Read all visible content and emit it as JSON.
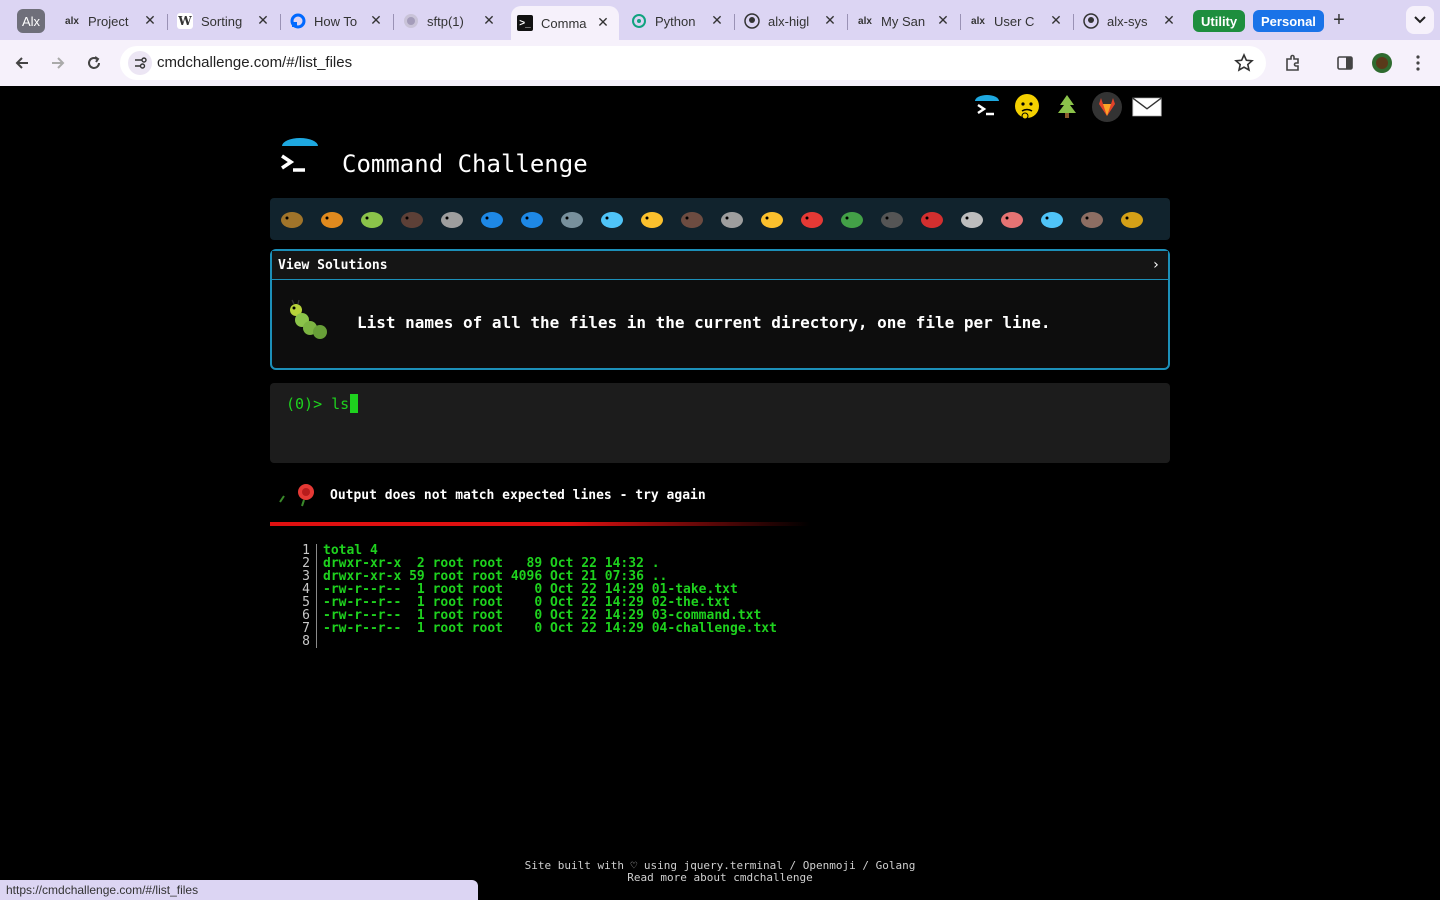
{
  "browser": {
    "profile_badge": "Alx",
    "tabs": [
      {
        "title": "Project",
        "icon": "alx-icon"
      },
      {
        "title": "Sorting",
        "icon": "wikipedia-icon"
      },
      {
        "title": "How To",
        "icon": "digitalocean-icon"
      },
      {
        "title": "sftp(1)",
        "icon": "globe-icon"
      },
      {
        "title": "Comma",
        "icon": "terminal-icon",
        "active": true
      },
      {
        "title": "Python",
        "icon": "chatgpt-icon"
      },
      {
        "title": "alx-higl",
        "icon": "github-icon"
      },
      {
        "title": "My San",
        "icon": "alx-icon"
      },
      {
        "title": "User C",
        "icon": "alx-icon"
      },
      {
        "title": "alx-sys",
        "icon": "github-icon"
      }
    ],
    "groups": [
      {
        "label": "Utility",
        "color": "#1e8e3e"
      },
      {
        "label": "Personal",
        "color": "#1a73e8"
      }
    ],
    "url": "cmdchallenge.com/#/list_files",
    "status_url": "https://cmdchallenge.com/#/list_files"
  },
  "page": {
    "title": "Command Challenge",
    "level_icons": [
      "snail-icon",
      "butterfly-icon",
      "caterpillar-icon",
      "ant-icon",
      "microbe-icon",
      "whale-icon",
      "dolphin-icon",
      "shark-icon",
      "fish-icon",
      "tropical-fish-icon",
      "hedgehog-icon",
      "wolf-icon",
      "bee-icon",
      "ladybug-icon",
      "lizard-icon",
      "spider-icon",
      "scorpion-icon",
      "fly-icon",
      "worm-icon",
      "paramecium-icon",
      "monkey-icon",
      "dog-icon"
    ],
    "challenge": {
      "header": "View Solutions",
      "chevron": "›",
      "description": "List names of all the files in the current directory, one file per line."
    },
    "terminal": {
      "prompt": "(0)> ",
      "command": "ls"
    },
    "result": {
      "message": "Output does not match expected lines - try again"
    },
    "output_lines": [
      {
        "n": "1",
        "text": "total 4"
      },
      {
        "n": "2",
        "text": "drwxr-xr-x  2 root root   89 Oct 22 14:32 ."
      },
      {
        "n": "3",
        "text": "drwxr-xr-x 59 root root 4096 Oct 21 07:36 .."
      },
      {
        "n": "4",
        "text": "-rw-r--r--  1 root root    0 Oct 22 14:29 01-take.txt"
      },
      {
        "n": "5",
        "text": "-rw-r--r--  1 root root    0 Oct 22 14:29 02-the.txt"
      },
      {
        "n": "6",
        "text": "-rw-r--r--  1 root root    0 Oct 22 14:29 03-command.txt"
      },
      {
        "n": "7",
        "text": "-rw-r--r--  1 root root    0 Oct 22 14:29 04-challenge.txt"
      },
      {
        "n": "8",
        "text": ""
      }
    ],
    "footer": {
      "line1": "Site built with ♡ using jquery.terminal / Openmoji / Golang",
      "line2": "Read more about cmdchallenge"
    }
  },
  "colors": {
    "terminal_green": "#1ed21e",
    "border_blue": "#1c8fb8",
    "error_red": "#e01010"
  }
}
